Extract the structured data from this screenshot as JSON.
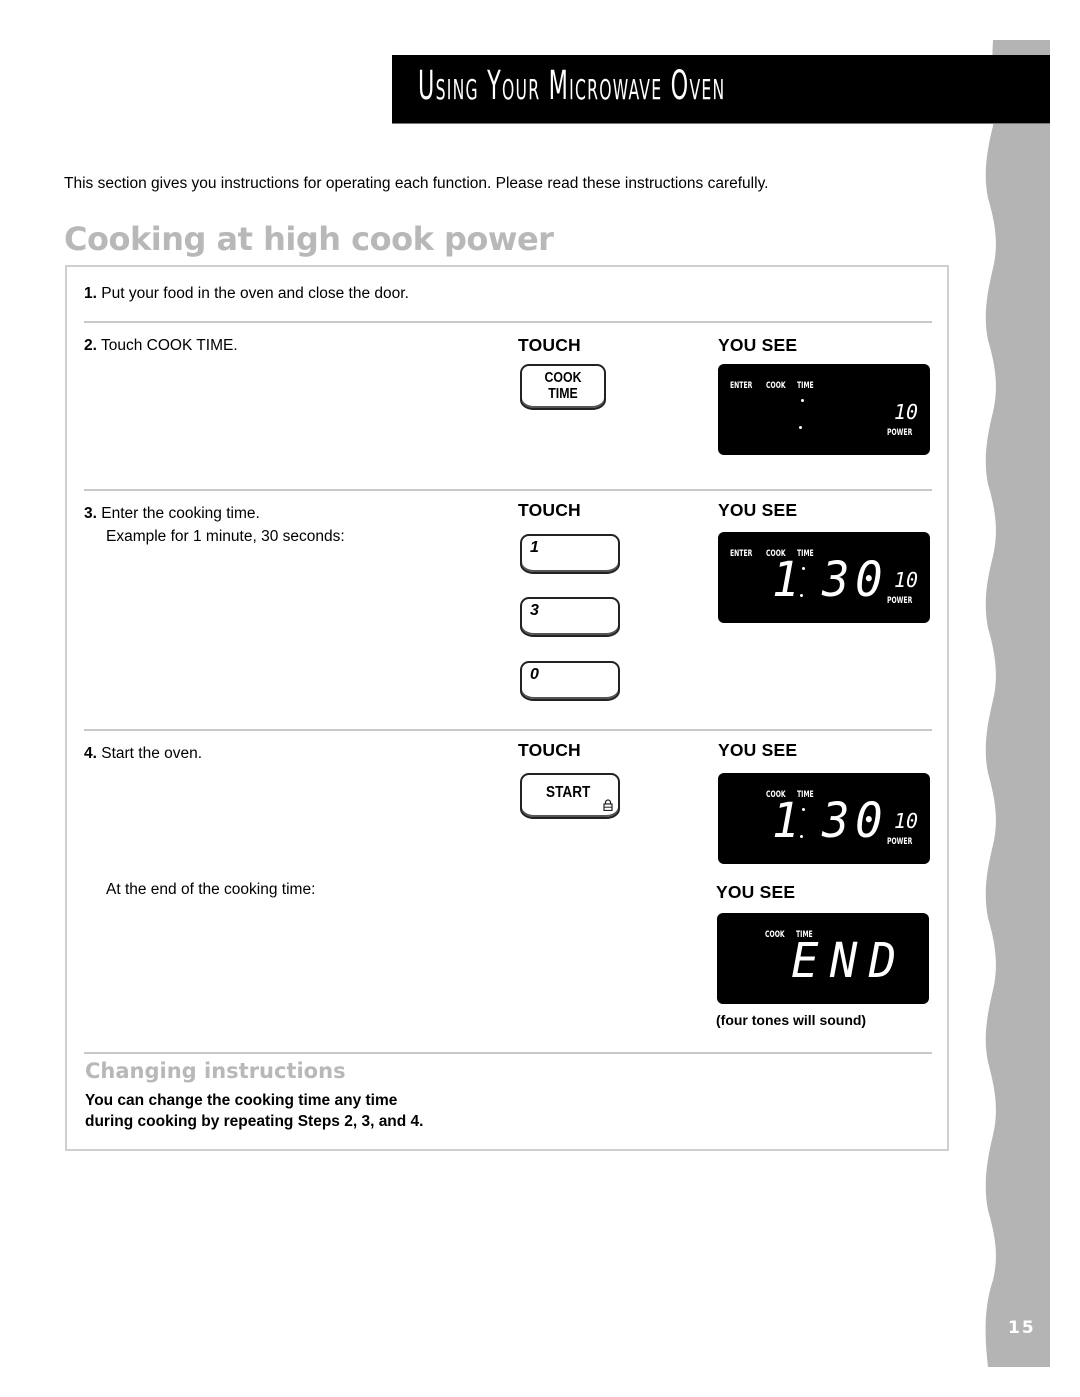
{
  "header": {
    "title": "Using Your Microwave Oven"
  },
  "intro": "This section gives you instructions for operating each function. Please read these instructions carefully.",
  "section_title": "Cooking at high cook power",
  "column_headers": {
    "touch": "TOUCH",
    "you_see": "YOU SEE"
  },
  "steps": [
    {
      "number": "1.",
      "text": "Put your food in the oven and close the door."
    },
    {
      "number": "2.",
      "text": "Touch COOK TIME.",
      "keys": [
        {
          "line1": "COOK",
          "line2": "TIME"
        }
      ],
      "display": {
        "labels": [
          "ENTER",
          "COOK",
          "TIME"
        ],
        "main": "",
        "power": "10",
        "power_label": "POWER"
      }
    },
    {
      "number": "3.",
      "text": "Enter the cooking time.",
      "subtext": "Example for 1 minute, 30 seconds:",
      "keys": [
        {
          "label": "1"
        },
        {
          "label": "3"
        },
        {
          "label": "0"
        }
      ],
      "display": {
        "labels": [
          "ENTER",
          "COOK",
          "TIME"
        ],
        "main_minutes": "1",
        "main_seconds": "30",
        "power": "10",
        "power_label": "POWER"
      }
    },
    {
      "number": "4.",
      "text": "Start the oven.",
      "keys": [
        {
          "label": "START",
          "icon": "lock-icon"
        }
      ],
      "display": {
        "labels": [
          "COOK",
          "TIME"
        ],
        "main_minutes": "1",
        "main_seconds": "30",
        "power": "10",
        "power_label": "POWER"
      }
    }
  ],
  "end_of_cooking": {
    "text": "At the end of the cooking time:",
    "header": "YOU SEE",
    "display": {
      "labels": [
        "COOK",
        "TIME"
      ],
      "main": "END"
    },
    "note": "(four tones will sound)"
  },
  "changing": {
    "title": "Changing instructions",
    "line1": "You can change the cooking time any time",
    "line2": "during cooking by repeating Steps 2, 3, and 4."
  },
  "page_number": "15"
}
